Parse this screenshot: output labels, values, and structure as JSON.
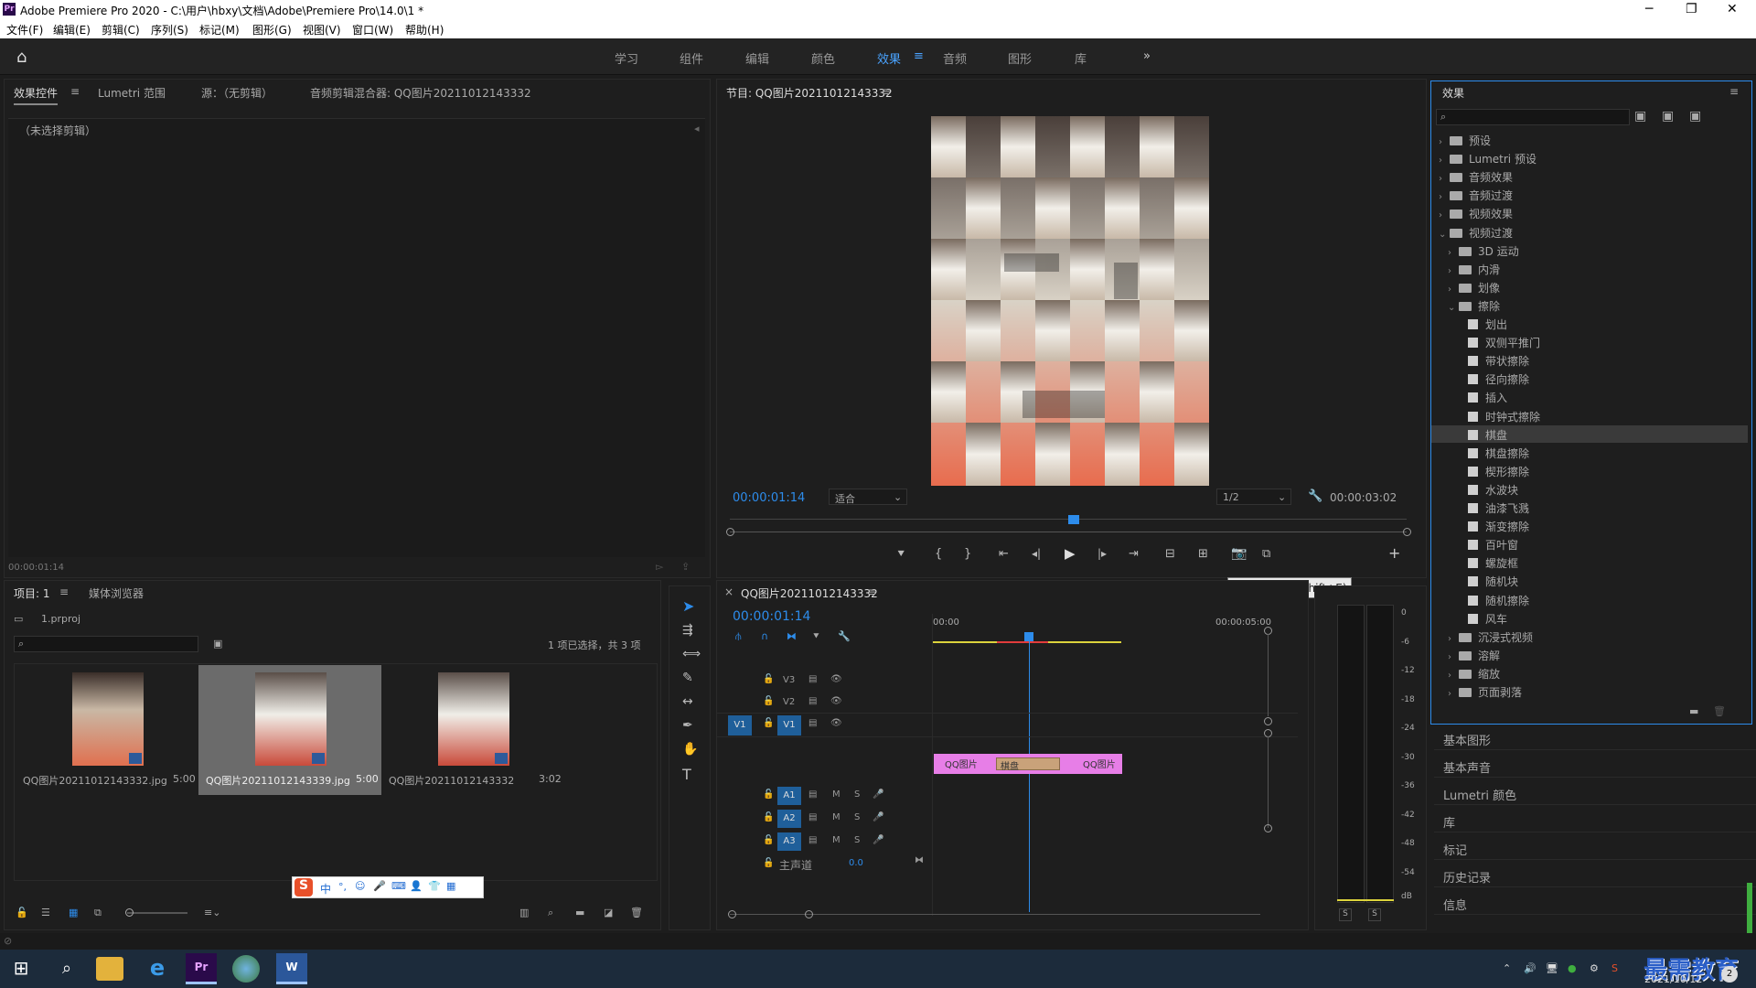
{
  "window": {
    "app_icon": "Pr",
    "title": "Adobe Premiere Pro 2020 - C:\\用户\\hbxy\\文档\\Adobe\\Premiere Pro\\14.0\\1 *",
    "controls": [
      "minimize-icon",
      "maximize-icon",
      "close-icon"
    ]
  },
  "menu": [
    "文件(F)",
    "编辑(E)",
    "剪辑(C)",
    "序列(S)",
    "标记(M)",
    "图形(G)",
    "视图(V)",
    "窗口(W)",
    "帮助(H)"
  ],
  "workspaces": {
    "items": [
      "学习",
      "组件",
      "编辑",
      "颜色",
      "效果",
      "音频",
      "图形",
      "库"
    ],
    "active": "效果",
    "menu_glyph": "≡",
    "more_glyph": "»"
  },
  "source_panel": {
    "tabs": [
      "效果控件",
      "Lumetri 范围",
      "源：（无剪辑）",
      "音频剪辑混合器: QQ图片20211012143332"
    ],
    "menu_glyph": "≡",
    "no_clip": "（未选择剪辑）",
    "timecode": "00:00:01:14"
  },
  "program_monitor": {
    "title": "节目: QQ图片20211012143332",
    "menu_glyph": "≡",
    "timecode": "00:00:01:14",
    "fit": "适合",
    "resolution": "1/2",
    "duration": "00:00:03:02",
    "tooltip": "导出帧 (Ctrl+Shift+E)"
  },
  "project_panel": {
    "tabs": [
      "项目: 1",
      "媒体浏览器"
    ],
    "menu_glyph": "≡",
    "file": "1.prproj",
    "selection_info": "1 项已选择，共 3 项",
    "items": [
      {
        "name": "QQ图片20211012143332.jpg",
        "duration": "5:00"
      },
      {
        "name": "QQ图片20211012143339.jpg",
        "duration": "5:00"
      },
      {
        "name": "QQ图片20211012143332",
        "duration": "3:02"
      }
    ]
  },
  "ime_bar": [
    "中",
    "°,",
    "☺",
    "🎤",
    "⌨",
    "👤",
    "👕",
    "▦"
  ],
  "timeline": {
    "close_glyph": "×",
    "sequence": "QQ图片20211012143332",
    "menu_glyph": "≡",
    "timecode": "00:00:01:14",
    "ruler": [
      "00:00",
      "00:00:05:00"
    ],
    "tracks_video": [
      "V3",
      "V2",
      "V1"
    ],
    "tracks_audio": [
      "A1",
      "A2",
      "A3"
    ],
    "source_patch": "V1",
    "master": "主声道",
    "master_value": "0.0",
    "clip_left": "QQ图片",
    "clip_transition": "棋盘",
    "clip_right": "QQ图片"
  },
  "audio_meter": {
    "scale": [
      "0",
      "-6",
      "-12",
      "-18",
      "-24",
      "-30",
      "-36",
      "-42",
      "-48",
      "-54",
      "dB"
    ],
    "solo": [
      "S",
      "S"
    ]
  },
  "effects_panel": {
    "title": "效果",
    "menu_glyph": "≡",
    "tree": [
      {
        "label": "预设",
        "level": 0,
        "type": "folder",
        "state": "closed"
      },
      {
        "label": "Lumetri 预设",
        "level": 0,
        "type": "folder",
        "state": "closed"
      },
      {
        "label": "音频效果",
        "level": 0,
        "type": "folder",
        "state": "closed"
      },
      {
        "label": "音频过渡",
        "level": 0,
        "type": "folder",
        "state": "closed"
      },
      {
        "label": "视频效果",
        "level": 0,
        "type": "folder",
        "state": "closed"
      },
      {
        "label": "视频过渡",
        "level": 0,
        "type": "folder",
        "state": "open"
      },
      {
        "label": "3D 运动",
        "level": 1,
        "type": "folder",
        "state": "closed"
      },
      {
        "label": "内滑",
        "level": 1,
        "type": "folder",
        "state": "closed"
      },
      {
        "label": "划像",
        "level": 1,
        "type": "folder",
        "state": "closed"
      },
      {
        "label": "擦除",
        "level": 1,
        "type": "folder",
        "state": "open"
      },
      {
        "label": "划出",
        "level": 2,
        "type": "effect"
      },
      {
        "label": "双侧平推门",
        "level": 2,
        "type": "effect"
      },
      {
        "label": "带状擦除",
        "level": 2,
        "type": "effect"
      },
      {
        "label": "径向擦除",
        "level": 2,
        "type": "effect"
      },
      {
        "label": "插入",
        "level": 2,
        "type": "effect"
      },
      {
        "label": "时钟式擦除",
        "level": 2,
        "type": "effect"
      },
      {
        "label": "棋盘",
        "level": 2,
        "type": "effect",
        "selected": true
      },
      {
        "label": "棋盘擦除",
        "level": 2,
        "type": "effect"
      },
      {
        "label": "楔形擦除",
        "level": 2,
        "type": "effect"
      },
      {
        "label": "水波块",
        "level": 2,
        "type": "effect"
      },
      {
        "label": "油漆飞溅",
        "level": 2,
        "type": "effect"
      },
      {
        "label": "渐变擦除",
        "level": 2,
        "type": "effect"
      },
      {
        "label": "百叶窗",
        "level": 2,
        "type": "effect"
      },
      {
        "label": "螺旋框",
        "level": 2,
        "type": "effect"
      },
      {
        "label": "随机块",
        "level": 2,
        "type": "effect"
      },
      {
        "label": "随机擦除",
        "level": 2,
        "type": "effect"
      },
      {
        "label": "风车",
        "level": 2,
        "type": "effect"
      },
      {
        "label": "沉浸式视频",
        "level": 1,
        "type": "folder",
        "state": "closed"
      },
      {
        "label": "溶解",
        "level": 1,
        "type": "folder",
        "state": "closed"
      },
      {
        "label": "缩放",
        "level": 1,
        "type": "folder",
        "state": "closed"
      },
      {
        "label": "页面剥落",
        "level": 1,
        "type": "folder",
        "state": "closed"
      }
    ]
  },
  "side_panels": [
    "基本图形",
    "基本声音",
    "Lumetri 颜色",
    "库",
    "标记",
    "历史记录",
    "信息"
  ],
  "taskbar": {
    "time": "2021/10/12",
    "watermark": "最需教育",
    "badge": "2"
  },
  "colors": {
    "accent": "#2d8ceb",
    "clip": "#e77ee7",
    "timeline_red": "#e23c3c",
    "timeline_yellow": "#dcd33c"
  }
}
